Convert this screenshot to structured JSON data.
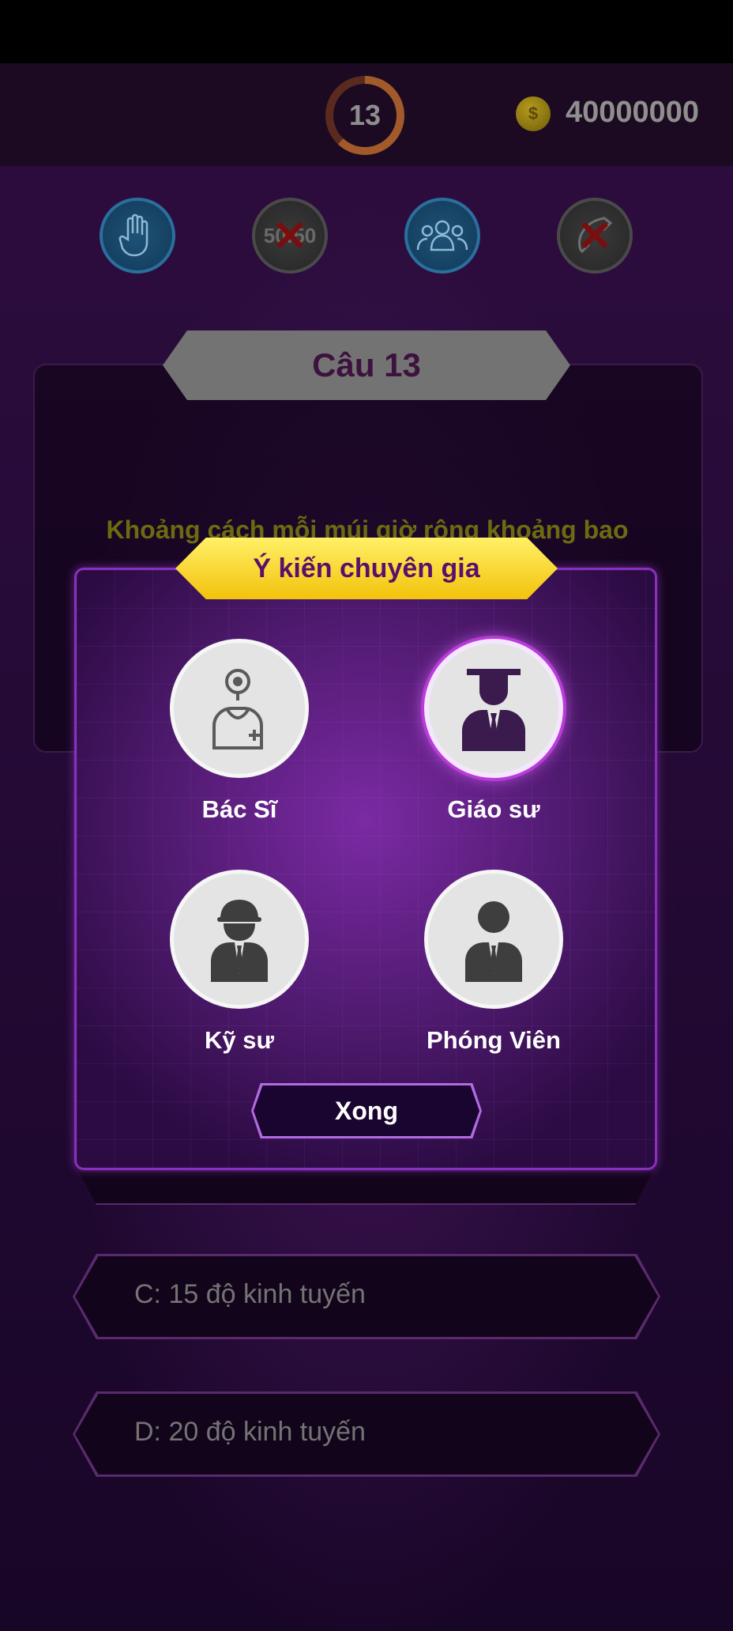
{
  "header": {
    "timer": "13",
    "coin_symbol": "$",
    "balance": "40000000"
  },
  "lifelines": [
    {
      "icon": "hand-icon",
      "used": false
    },
    {
      "icon": "fifty-fifty-icon",
      "label": "50:50",
      "used": true
    },
    {
      "icon": "audience-icon",
      "used": false
    },
    {
      "icon": "phone-call-icon",
      "used": true
    }
  ],
  "question": {
    "number_label": "Câu 13",
    "text": "Khoảng cách mỗi múi giờ rộng khoảng bao"
  },
  "answers": [
    {
      "label": "C: 15 độ kinh tuyến"
    },
    {
      "label": "D: 20 độ kinh tuyến"
    }
  ],
  "expert_dialog": {
    "title": "Ý kiến chuyên gia",
    "experts": [
      {
        "label": "Bác Sĩ",
        "icon": "doctor-icon",
        "selected": false
      },
      {
        "label": "Giáo sư",
        "icon": "professor-icon",
        "selected": true
      },
      {
        "label": "Kỹ sư",
        "icon": "engineer-icon",
        "selected": false
      },
      {
        "label": "Phóng Viên",
        "icon": "reporter-icon",
        "selected": false
      }
    ],
    "done_label": "Xong"
  },
  "colors": {
    "background": "#2a0c3a",
    "title_yellow": "#f6d21a",
    "modal_border": "#8a2fbf",
    "selected_glow": "#d05cf0"
  }
}
